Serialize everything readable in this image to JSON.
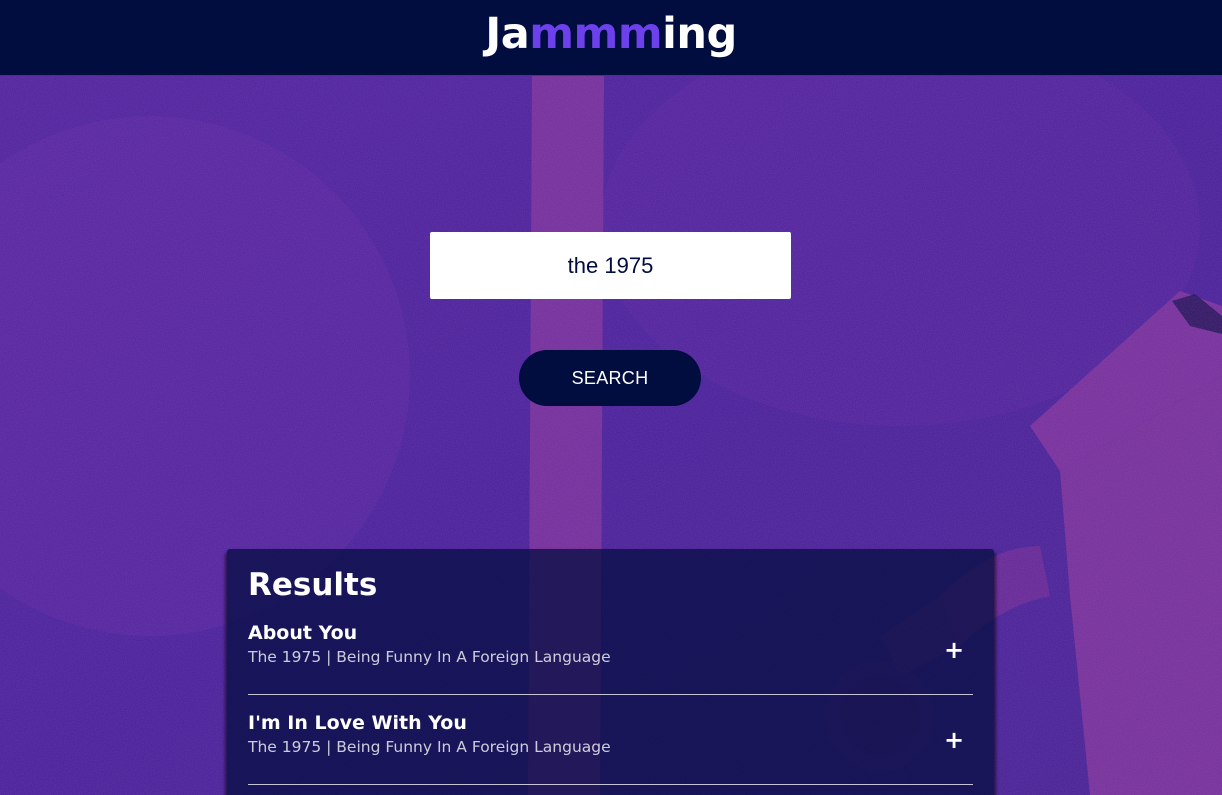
{
  "header": {
    "logo_prefix": "Ja",
    "logo_highlight": "mmm",
    "logo_suffix": "ing"
  },
  "search": {
    "value": "the 1975",
    "button_label": "SEARCH"
  },
  "results": {
    "title": "Results",
    "add_symbol": "+",
    "tracks": [
      {
        "name": "About You",
        "meta": "The 1975 | Being Funny In A Foreign Language"
      },
      {
        "name": "I'm In Love With You",
        "meta": "The 1975 | Being Funny In A Foreign Language"
      }
    ]
  },
  "colors": {
    "header_bg": "#010c3f",
    "accent": "#6c41ec",
    "background_purple": "#3b1a8e"
  }
}
